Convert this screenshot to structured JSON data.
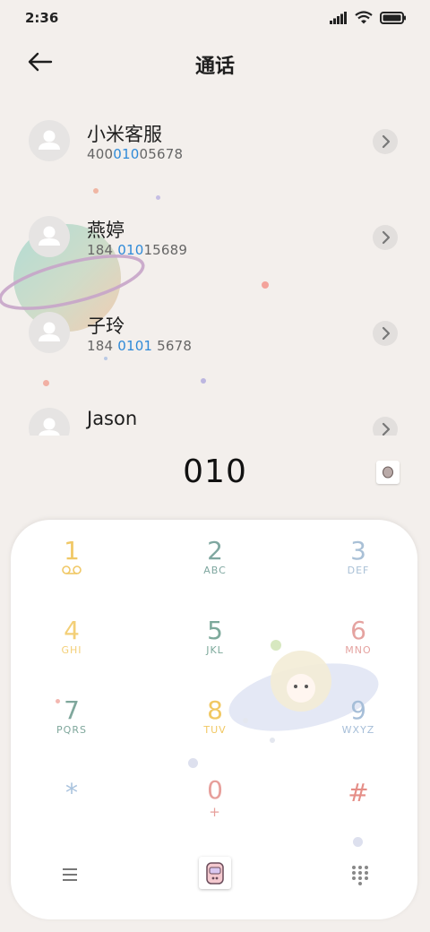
{
  "status": {
    "time": "2:36"
  },
  "header": {
    "title": "通话"
  },
  "contacts": [
    {
      "name": "小米客服",
      "num_pre": "400",
      "num_hl": "010",
      "num_post": "05678"
    },
    {
      "name": "燕婷",
      "num_pre": "184 ",
      "num_hl": "010",
      "num_post": "15689"
    },
    {
      "name": "子玲",
      "num_pre": "184 ",
      "num_hl": "0101",
      "num_post": " 5678"
    },
    {
      "name": "Jason",
      "num_pre": "",
      "num_hl": "",
      "num_post": ""
    }
  ],
  "dial": {
    "number": "010"
  },
  "keypad": {
    "keys": [
      {
        "digit": "1",
        "letters": "",
        "color": "#f0c866"
      },
      {
        "digit": "2",
        "letters": "ABC",
        "color": "#7fa7a0"
      },
      {
        "digit": "3",
        "letters": "DEF",
        "color": "#a9c0d6"
      },
      {
        "digit": "4",
        "letters": "GHI",
        "color": "#f3cf77"
      },
      {
        "digit": "5",
        "letters": "JKL",
        "color": "#7da99b"
      },
      {
        "digit": "6",
        "letters": "MNO",
        "color": "#e5a3a0"
      },
      {
        "digit": "7",
        "letters": "PQRS",
        "color": "#7fa79c"
      },
      {
        "digit": "8",
        "letters": "TUV",
        "color": "#f1c863"
      },
      {
        "digit": "9",
        "letters": "WXYZ",
        "color": "#a6bed8"
      },
      {
        "digit": "*",
        "letters": "",
        "color": "#a9c3de"
      },
      {
        "digit": "0",
        "letters": "+",
        "color": "#e79f9b"
      },
      {
        "digit": "#",
        "letters": "",
        "color": "#e58e87"
      }
    ]
  },
  "icons": {
    "signal": "signal-icon",
    "wifi": "wifi-icon",
    "battery": "battery-icon",
    "back": "back-arrow-icon",
    "menu": "menu-icon",
    "dialpad": "dialpad-icon",
    "call": "call-sticker-icon"
  }
}
